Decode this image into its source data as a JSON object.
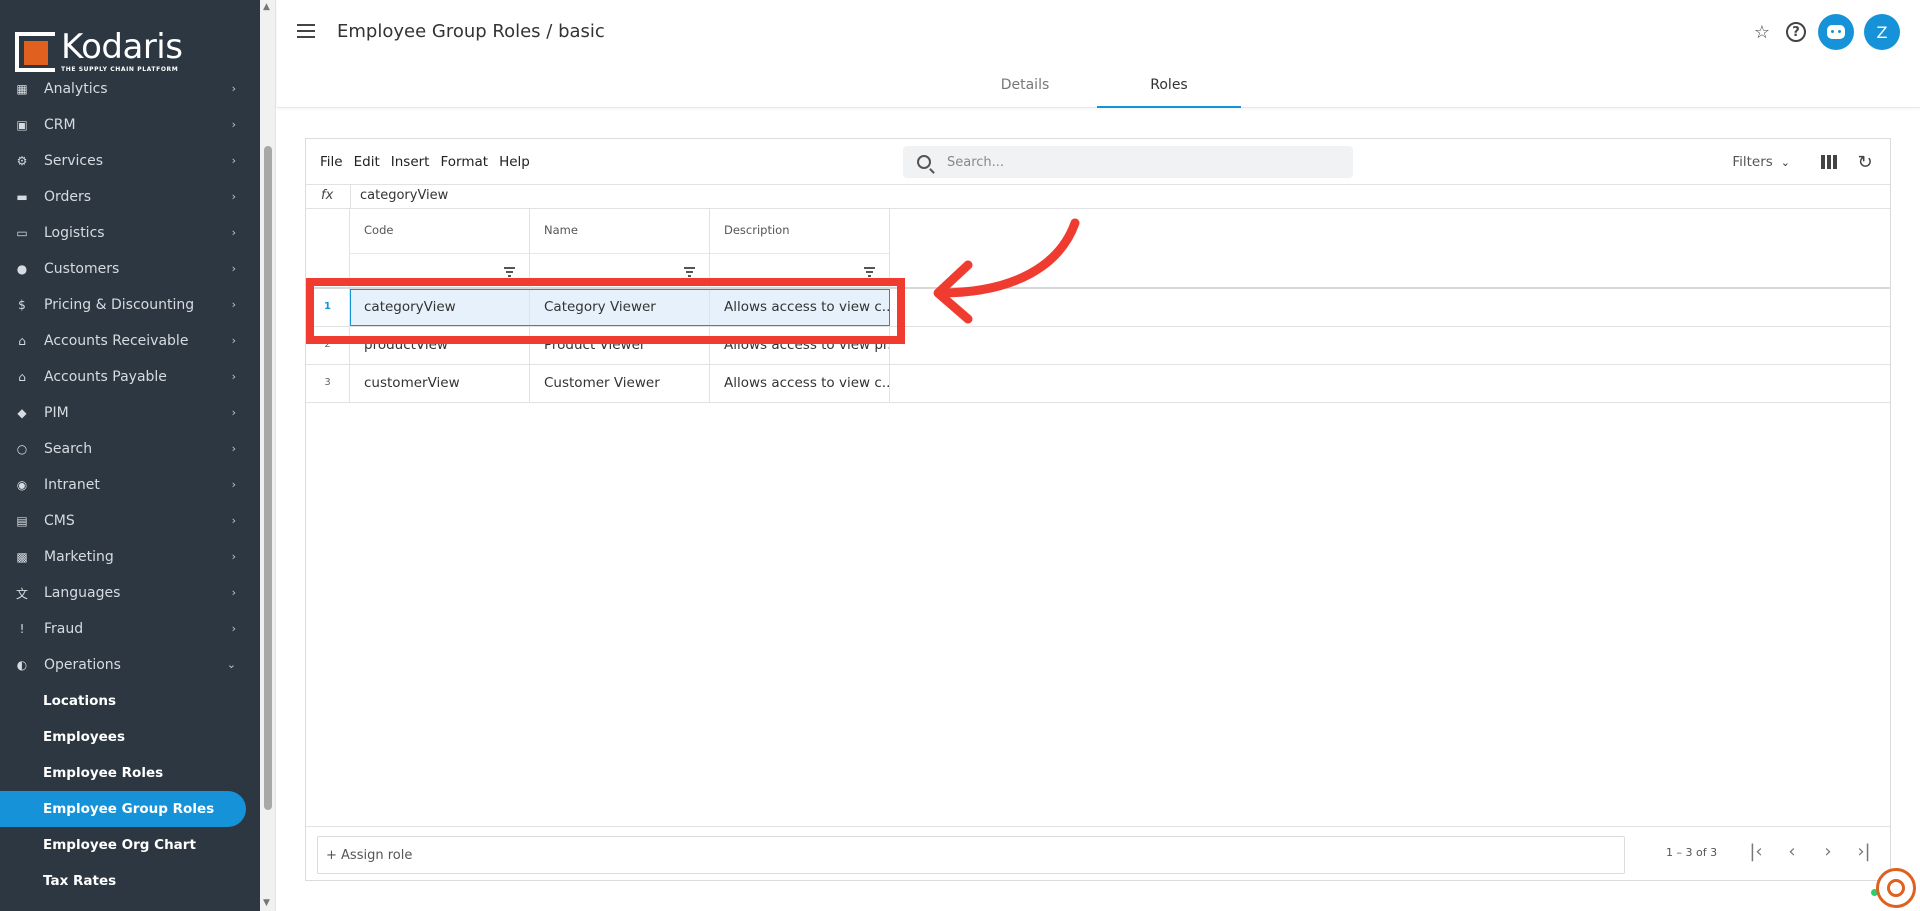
{
  "brand": {
    "name": "Kodaris",
    "tagline": "THE SUPPLY CHAIN PLATFORM",
    "accent": "#e0601f",
    "primary": "#1592d8"
  },
  "sidebar": {
    "items": [
      {
        "label": "Analytics",
        "icon": "chart-icon"
      },
      {
        "label": "CRM",
        "icon": "contact-icon"
      },
      {
        "label": "Services",
        "icon": "services-icon"
      },
      {
        "label": "Orders",
        "icon": "truck-icon"
      },
      {
        "label": "Logistics",
        "icon": "shipping-icon"
      },
      {
        "label": "Customers",
        "icon": "people-icon"
      },
      {
        "label": "Pricing & Discounting",
        "icon": "dollar-icon"
      },
      {
        "label": "Accounts Receivable",
        "icon": "bank-icon"
      },
      {
        "label": "Accounts Payable",
        "icon": "bank-icon"
      },
      {
        "label": "PIM",
        "icon": "tag-icon"
      },
      {
        "label": "Search",
        "icon": "search-icon"
      },
      {
        "label": "Intranet",
        "icon": "globe-icon"
      },
      {
        "label": "CMS",
        "icon": "window-icon"
      },
      {
        "label": "Marketing",
        "icon": "id-card-icon"
      },
      {
        "label": "Languages",
        "icon": "translate-icon"
      },
      {
        "label": "Fraud",
        "icon": "alert-icon"
      },
      {
        "label": "Operations",
        "icon": "palette-icon"
      }
    ],
    "operations_sub": [
      {
        "label": "Locations"
      },
      {
        "label": "Employees"
      },
      {
        "label": "Employee Roles"
      },
      {
        "label": "Employee Group Roles"
      },
      {
        "label": "Employee Org Chart"
      },
      {
        "label": "Tax Rates"
      }
    ]
  },
  "header": {
    "title": "Employee Group Roles / basic",
    "avatar_initial": "Z",
    "tabs": [
      {
        "label": "Details"
      },
      {
        "label": "Roles"
      }
    ]
  },
  "toolbar": {
    "menu": [
      "File",
      "Edit",
      "Insert",
      "Format",
      "Help"
    ],
    "search_placeholder": "Search...",
    "filters_label": "Filters"
  },
  "formula_bar": {
    "label": "fx",
    "value": "categoryView"
  },
  "grid": {
    "columns": [
      "Code",
      "Name",
      "Description"
    ],
    "rows": [
      {
        "num": "1",
        "code": "categoryView",
        "name": "Category Viewer",
        "description": "Allows access to view c..."
      },
      {
        "num": "2",
        "code": "productView",
        "name": "Product Viewer",
        "description": "Allows access to view pr..."
      },
      {
        "num": "3",
        "code": "customerView",
        "name": "Customer Viewer",
        "description": "Allows access to view c..."
      }
    ]
  },
  "footer": {
    "assign_label": "+ Assign role",
    "pager_info": "1 – 3 of 3"
  }
}
